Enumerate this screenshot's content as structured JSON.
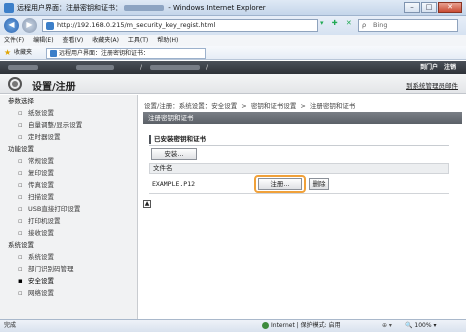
{
  "window": {
    "title": "远程用户界面：注册密钥和证书：",
    "title_suffix": "- Windows Internet Explorer",
    "minimize": "–",
    "maximize": "□",
    "close": "✕"
  },
  "address": {
    "back": "◀",
    "forward": "▶",
    "url": "http://192.168.0.215/m_security_key_regist.html",
    "buttons": "▾ ✚ ✕",
    "search_placeholder": "Bing",
    "search_glyph": "ρ"
  },
  "menu": [
    "文件(F)",
    "编辑(E)",
    "查看(V)",
    "收藏夹(A)",
    "工具(T)",
    "帮助(H)"
  ],
  "favorites": {
    "label": "收藏夹",
    "tab_title": "远程用户界面：注册密钥和证书："
  },
  "app": {
    "slash1": "/",
    "slash2": "/",
    "logout_links": [
      "到门户",
      "注销"
    ],
    "heading": "设置/注册",
    "portal_link": "到系统管理员邮件"
  },
  "sidebar": {
    "groups": [
      {
        "label": "参数选择",
        "items": [
          "纸张设置",
          "自量调整/显示设置",
          "定时器设置"
        ]
      },
      {
        "label": "功能设置",
        "items": [
          "常规设置",
          "复印设置",
          "传真设置",
          "扫描设置",
          "USB直接打印设置",
          "打印机设置",
          "接收设置"
        ]
      },
      {
        "label": "系统设置",
        "items": [
          "系统设置",
          "部门识别码管理",
          "安全设置",
          "网络设置"
        ]
      }
    ],
    "active_item": "安全设置"
  },
  "main": {
    "breadcrumb": [
      "设置/注册：系统设置：安全设置",
      "密钥和证书设置",
      "注册密钥和证书"
    ],
    "breadcrumb_sep": ">",
    "page_title": "注册密钥和证书",
    "section_title": "已安装密钥和证书",
    "install_button": "安装...",
    "column_filename": "文件名",
    "file_name": "EXAMPLE.P12",
    "register_button": "注册...",
    "delete_button": "删除",
    "to_top": "▲"
  },
  "status": {
    "done": "完成",
    "zone": "Internet | 保护模式: 启用",
    "misc": "⊕ ▾",
    "zoom": "🔍 100%  ▾"
  }
}
